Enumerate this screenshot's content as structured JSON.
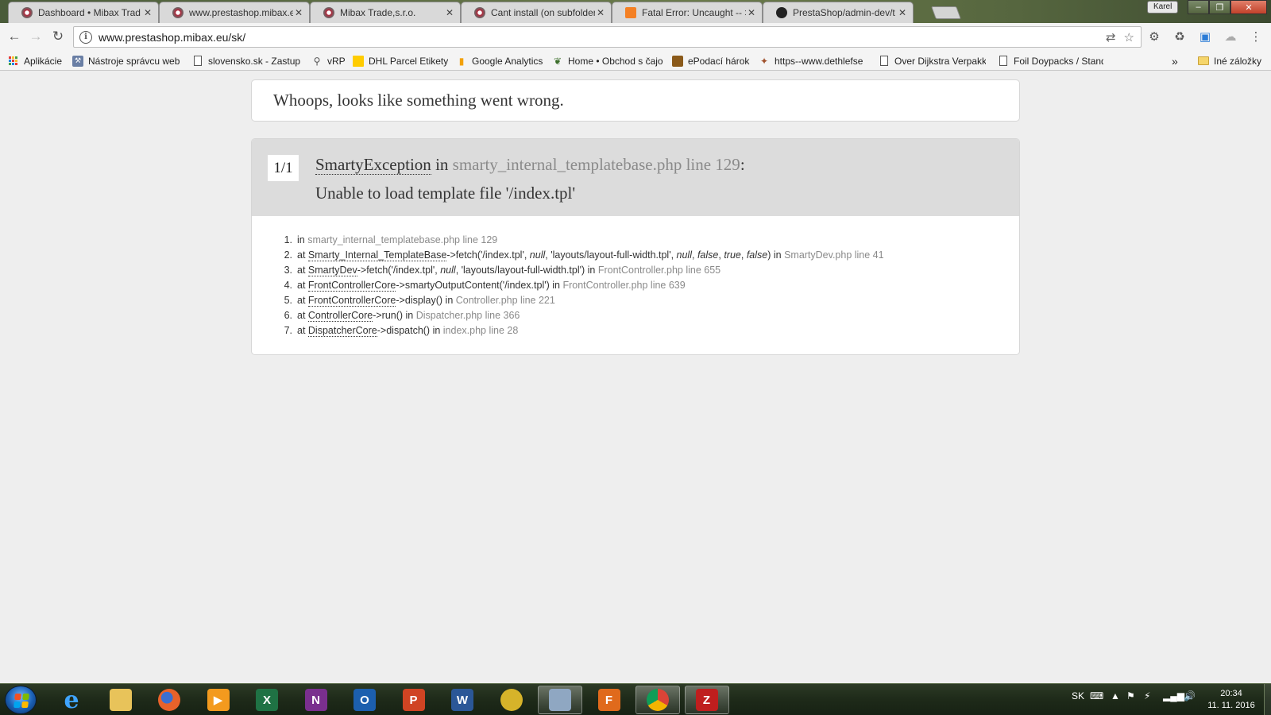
{
  "browser": {
    "tabs": [
      {
        "title": "Dashboard • Mibax Trad",
        "active": false
      },
      {
        "title": "www.prestashop.mibax.e",
        "active": true
      },
      {
        "title": "Mibax Trade,s.r.o.",
        "active": false
      },
      {
        "title": "Cant install (on subfolder",
        "active": false
      },
      {
        "title": "Fatal Error: Uncaught -- >",
        "active": false
      },
      {
        "title": "PrestaShop/admin-dev/t",
        "active": false
      }
    ],
    "profile_name": "Karel",
    "address_bar": {
      "url": "www.prestashop.mibax.eu/sk/"
    },
    "bookmarks": [
      {
        "label": "Aplikácie",
        "icon": "apps-grid-icon"
      },
      {
        "label": "Nástroje správcu web",
        "icon": "webmaster-tools-icon"
      },
      {
        "label": "slovensko.sk - Zastup",
        "icon": "page-icon"
      },
      {
        "label": "vRP",
        "icon": "vrp-icon"
      },
      {
        "label": "DHL Parcel Etikety",
        "icon": "dhl-icon"
      },
      {
        "label": "Google Analytics",
        "icon": "analytics-icon"
      },
      {
        "label": "Home • Obchod s čajo",
        "icon": "tea-shop-icon"
      },
      {
        "label": "ePodací hárok",
        "icon": "epodaci-icon"
      },
      {
        "label": "https--www.dethlefse",
        "icon": "dethlefsen-icon"
      },
      {
        "label": "Over Dijkstra Verpakk",
        "icon": "page-icon"
      },
      {
        "label": "Foil Doypacks / Stand",
        "icon": "page-icon"
      }
    ],
    "bookmarks_overflow": "»",
    "other_bookmarks": "Iné záložky"
  },
  "page": {
    "whoops_message": "Whoops, looks like something went wrong.",
    "exception": {
      "count": "1/1",
      "class_name": "SmartyException",
      "in_word": " in ",
      "location": "smarty_internal_templatebase.php line 129",
      "colon": ":",
      "message": "Unable to load template file '/index.tpl'"
    },
    "trace": [
      {
        "num": "1.",
        "prefix": "in ",
        "file": "smarty_internal_templatebase.php line 129"
      },
      {
        "num": "2.",
        "prefix": "at ",
        "class": "Smarty_Internal_TemplateBase",
        "call_a": "->fetch('/index.tpl', ",
        "null": "null",
        "call_b": ", 'layouts/layout-full-width.tpl', ",
        "null2": "null",
        "sep1": ", ",
        "false1": "false",
        "sep2": ", ",
        "true1": "true",
        "sep3": ", ",
        "false2": "false",
        "call_c": ") in ",
        "file": "SmartyDev.php line 41"
      },
      {
        "num": "3.",
        "prefix": "at ",
        "class": "SmartyDev",
        "call_a": "->fetch('/index.tpl', ",
        "null": "null",
        "call_b": ", 'layouts/layout-full-width.tpl') in ",
        "file": "FrontController.php line 655"
      },
      {
        "num": "4.",
        "prefix": "at ",
        "class": "FrontControllerCore",
        "call_a": "->smartyOutputContent('/index.tpl') in ",
        "file": "FrontController.php line 639"
      },
      {
        "num": "5.",
        "prefix": "at ",
        "class": "FrontControllerCore",
        "call_a": "->display() in ",
        "file": "Controller.php line 221"
      },
      {
        "num": "6.",
        "prefix": "at ",
        "class": "ControllerCore",
        "call_a": "->run() in ",
        "file": "Dispatcher.php line 366"
      },
      {
        "num": "7.",
        "prefix": "at ",
        "class": "DispatcherCore",
        "call_a": "->dispatch() in ",
        "file": "index.php line 28"
      }
    ]
  },
  "taskbar": {
    "apps": [
      {
        "name": "internet-explorer-icon",
        "label": "e",
        "color": "#1e7fd8"
      },
      {
        "name": "file-explorer-icon",
        "label": "",
        "color": "#e8c35a"
      },
      {
        "name": "firefox-icon",
        "label": "",
        "color": "#e8622a"
      },
      {
        "name": "media-player-icon",
        "label": "▶",
        "color": "#f39a1e"
      },
      {
        "name": "excel-icon",
        "label": "X",
        "color": "#1f7244"
      },
      {
        "name": "onenote-icon",
        "label": "N",
        "color": "#7a2f8e"
      },
      {
        "name": "outlook-icon",
        "label": "O",
        "color": "#1c5fae"
      },
      {
        "name": "powerpoint-icon",
        "label": "P",
        "color": "#d04423"
      },
      {
        "name": "word-icon",
        "label": "W",
        "color": "#2b5797"
      },
      {
        "name": "coins-app-icon",
        "label": "",
        "color": "#d6b32a"
      },
      {
        "name": "certificate-app-icon",
        "label": "",
        "color": "#8fa7c2"
      },
      {
        "name": "foxit-reader-icon",
        "label": "F",
        "color": "#e06a1c"
      },
      {
        "name": "chrome-icon",
        "label": "",
        "color": "#db4437"
      },
      {
        "name": "filezilla-icon",
        "label": "Z",
        "color": "#bf1e1e"
      }
    ],
    "language": "SK",
    "time": "20:34",
    "date": "11. 11. 2016"
  }
}
